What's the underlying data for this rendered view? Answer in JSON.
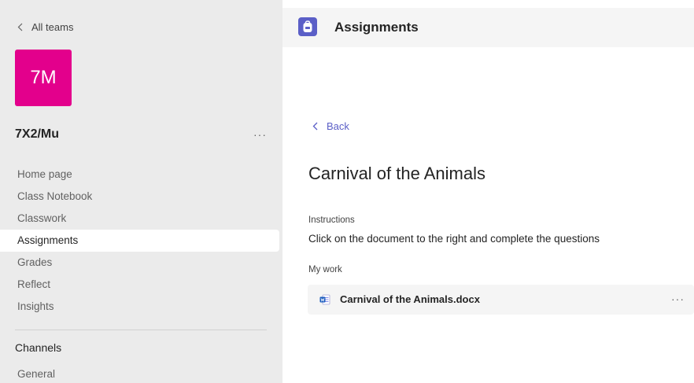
{
  "sidebar": {
    "all_teams_label": "All teams",
    "team": {
      "initials": "7M",
      "name": "7X2/Mu",
      "more": "···",
      "color": "#e3008c"
    },
    "items": [
      {
        "label": "Home page"
      },
      {
        "label": "Class Notebook"
      },
      {
        "label": "Classwork"
      },
      {
        "label": "Assignments",
        "active": true
      },
      {
        "label": "Grades"
      },
      {
        "label": "Reflect"
      },
      {
        "label": "Insights"
      }
    ],
    "channels_title": "Channels",
    "channels": [
      {
        "label": "General"
      }
    ]
  },
  "header": {
    "title": "Assignments",
    "icon": "backpack-icon",
    "accent": "#5b5fc7"
  },
  "assignment": {
    "back_label": "Back",
    "title": "Carnival of the Animals",
    "instructions_label": "Instructions",
    "instructions_text": "Click on the document to the right and complete the questions",
    "mywork_label": "My work",
    "file": {
      "name": "Carnival of the Animals.docx",
      "icon": "word-doc-icon",
      "more": "···"
    }
  }
}
